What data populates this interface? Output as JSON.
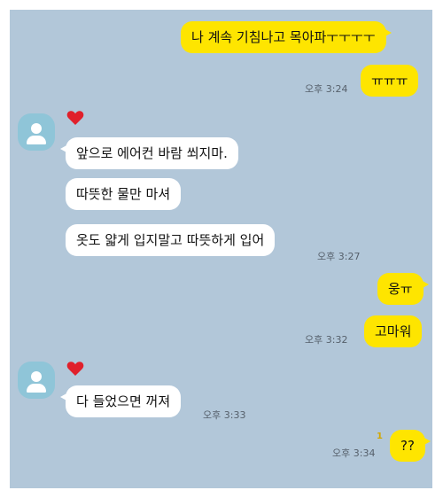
{
  "colors": {
    "background": "#b2c7d9",
    "my_bubble": "#fee500",
    "their_bubble": "#ffffff",
    "avatar": "#8fc5d8",
    "heart": "#e0202b"
  },
  "icons": {
    "avatar": "default-profile-icon",
    "reaction": "heart-icon"
  },
  "messages": {
    "m1": {
      "text": "나 계속 기침나고 목아파ㅜㅜㅜㅜ"
    },
    "m2": {
      "text": "ㅠㅠㅠ",
      "time": "오후 3:24"
    },
    "m3": {
      "text": "앞으로 에어컨 바람 쐬지마."
    },
    "m4": {
      "text": "따뜻한 물만 마셔"
    },
    "m5": {
      "text": "옷도 얇게 입지말고 따뜻하게 입어",
      "time": "오후 3:27"
    },
    "m6": {
      "text": "웅ㅠ"
    },
    "m7": {
      "text": "고마워",
      "time": "오후 3:32"
    },
    "m8": {
      "text": "다 들었으면 꺼져",
      "time": "오후 3:33"
    },
    "m9": {
      "text": "??",
      "time": "오후 3:34",
      "unread": "1"
    }
  }
}
